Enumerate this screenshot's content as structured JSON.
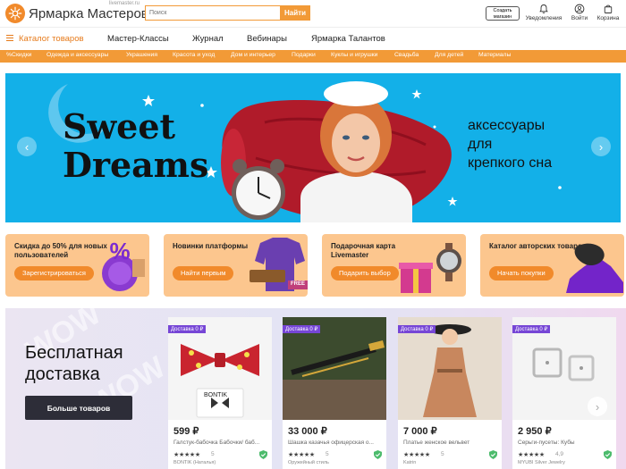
{
  "header": {
    "logo_text": "Ярмарка Мастеров",
    "logo_sub": "livemaster.ru",
    "search_placeholder": "Поиск",
    "search_button": "Найти",
    "create_shop": "Создать магазин",
    "notifications": "Уведомления",
    "login": "Войти",
    "cart": "Корзина"
  },
  "main_nav": {
    "catalog": "Каталог товаров",
    "items": [
      "Мастер-Классы",
      "Журнал",
      "Вебинары",
      "Ярмарка Талантов"
    ]
  },
  "categories": [
    "%Скидки",
    "Одежда и аксессуары",
    "Украшения",
    "Красота и уход",
    "Дом и интерьер",
    "Подарки",
    "Куклы и игрушки",
    "Свадьба",
    "Для детей",
    "Материалы"
  ],
  "banner": {
    "title_line1": "Sweet",
    "title_line2": "Dreams",
    "subtitle_line1": "аксессуары",
    "subtitle_line2": "для",
    "subtitle_line3": "крепкого сна",
    "bg_color": "#13b0e8"
  },
  "promos": [
    {
      "title": "Скидка до 50% для новых пользователей",
      "button": "Зарегистрироваться"
    },
    {
      "title": "Новинки платформы",
      "button": "Найти первым",
      "badge": "FREE"
    },
    {
      "title": "Подарочная карта Livemaster",
      "button": "Подарить выбор"
    },
    {
      "title": "Каталог авторских товаров",
      "button": "Начать покупки"
    }
  ],
  "wow": {
    "title_line1": "Бесплатная",
    "title_line2": "доставка",
    "button": "Больше товаров",
    "deco": "WOW"
  },
  "products": [
    {
      "tag": "Доставка 0 ₽",
      "price": "599 ₽",
      "name": "Галстук-бабочка Бабочки/ баб...",
      "stars": "★★★★★",
      "rating": "5",
      "shop": "BONTIK (Наталья)",
      "brand": "BONTIK"
    },
    {
      "tag": "Доставка 0 ₽",
      "price": "33 000 ₽",
      "name": "Шашка казачья офицерская о...",
      "stars": "★★★★★",
      "rating": "5",
      "shop": "Оружейный стиль"
    },
    {
      "tag": "Доставка 0 ₽",
      "price": "7 000 ₽",
      "name": "Платье женское вельвет",
      "stars": "★★★★★",
      "rating": "5",
      "shop": "Katrin"
    },
    {
      "tag": "Доставка 0 ₽",
      "price": "2 950 ₽",
      "name": "Серьги-пусеты: Кубы",
      "stars": "★★★★★",
      "rating": "4,9",
      "shop": "MYUBI Silver Jewelry"
    }
  ],
  "colors": {
    "accent": "#f29a37",
    "catalog": "#e67a1a",
    "promo_bg": "#fcc68e",
    "tag": "#7646d6",
    "dark_button": "#2d2d38"
  }
}
